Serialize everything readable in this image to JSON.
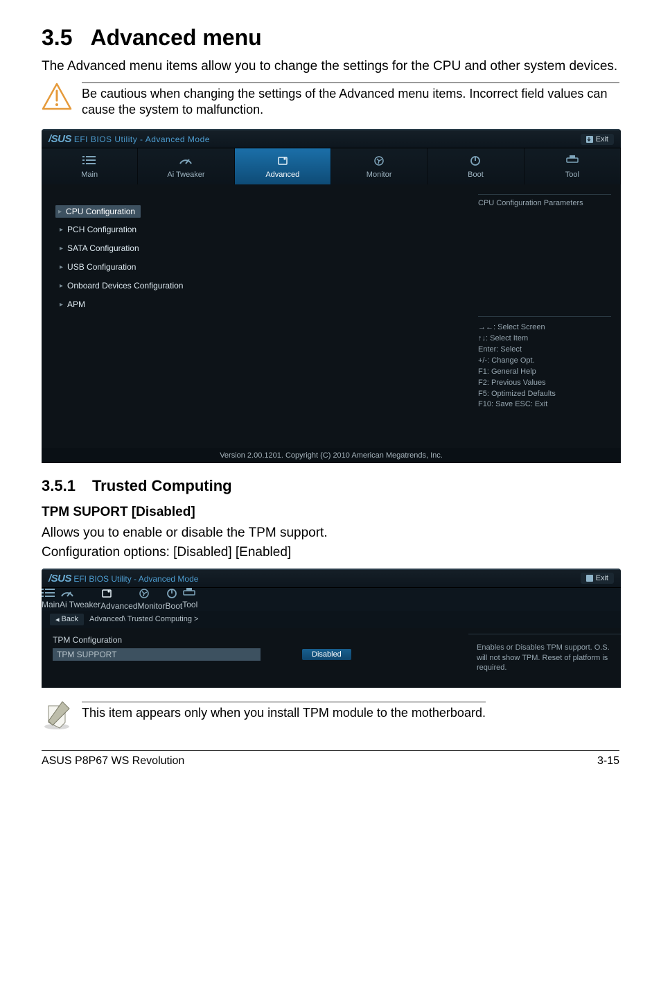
{
  "heading": {
    "number": "3.5",
    "title": "Advanced menu"
  },
  "intro": "The Advanced menu items allow you to change the settings for the CPU and other system devices.",
  "warn": "Be cautious when changing the settings of the Advanced menu items. Incorrect field values can cause the system to malfunction.",
  "bios1": {
    "brand_bold": "/SUS",
    "brand_rest": " EFI BIOS Utility - Advanced Mode",
    "exit": "Exit",
    "tabs": [
      "Main",
      "Ai  Tweaker",
      "Advanced",
      "Monitor",
      "Boot",
      "Tool"
    ],
    "tab_active_index": 2,
    "items": [
      "CPU Configuration",
      "PCH Configuration",
      "SATA Configuration",
      "USB Configuration",
      "Onboard Devices Configuration",
      "APM"
    ],
    "item_hl_index": 0,
    "help_top": "CPU Configuration Parameters",
    "keys": [
      "→←: Select Screen",
      "↑↓: Select Item",
      "Enter: Select",
      "+/-: Change Opt.",
      "F1: General Help",
      "F2: Previous Values",
      "F5: Optimized Defaults",
      "F10: Save   ESC: Exit"
    ],
    "footer": "Version  2.00.1201.   Copyright  (C)  2010  American  Megatrends,  Inc."
  },
  "sub1": {
    "number": "3.5.1",
    "title": "Trusted Computing"
  },
  "sub2": "TPM SUPORT [Disabled]",
  "sub2_body1": "Allows you to enable or disable the TPM support.",
  "sub2_body2": "Configuration options: [Disabled] [Enabled]",
  "bios2": {
    "crumb_back": "Back",
    "crumb_path": "Advanced\\  Trusted Computing  >",
    "row_label": "TPM Configuration",
    "row_name": "TPM SUPPORT",
    "row_value": "Disabled",
    "help": "Enables or Disables TPM support. O.S. will not show TPM. Reset of platform is required."
  },
  "note": "This item appears only when you install TPM module to the motherboard.",
  "footer": {
    "left": "ASUS P8P67 WS Revolution",
    "right": "3-15"
  }
}
